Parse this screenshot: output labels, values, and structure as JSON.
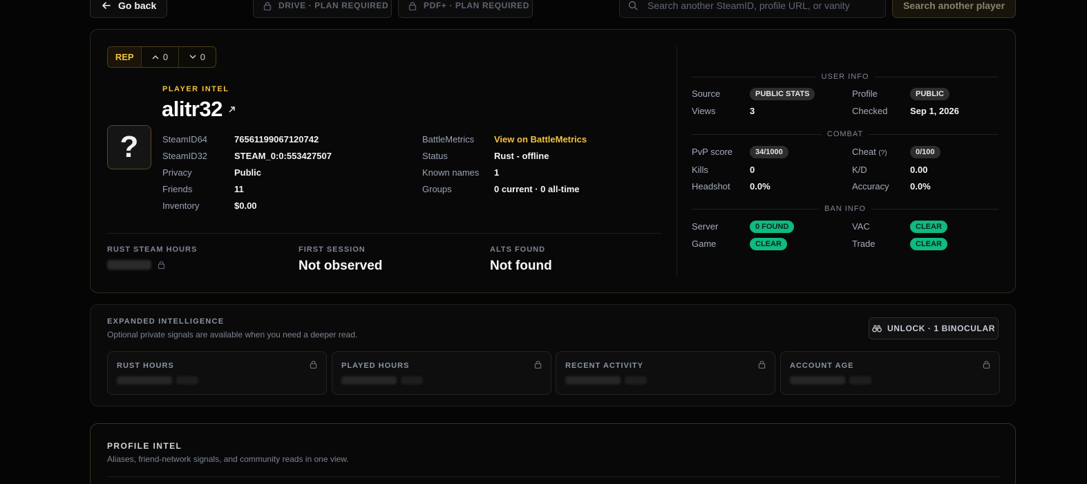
{
  "topbar": {
    "back_label": "Go back",
    "drive_label": "DRIVE · PLAN REQUIRED",
    "pdf_label": "PDF+ · PLAN REQUIRED",
    "search_placeholder": "Search another SteamID, profile URL, or vanity",
    "search_button": "Search another player"
  },
  "rep": {
    "label": "REP",
    "up": "0",
    "down": "0"
  },
  "player": {
    "tag": "PLAYER INTEL",
    "name": "alitr32",
    "avatar_glyph": "?",
    "fields_left": [
      {
        "k": "SteamID64",
        "v": "76561199067120742"
      },
      {
        "k": "SteamID32",
        "v": "STEAM_0:0:553427507"
      },
      {
        "k": "Privacy",
        "v": "Public"
      },
      {
        "k": "Friends",
        "v": "11"
      },
      {
        "k": "Inventory",
        "v": "$0.00"
      }
    ],
    "fields_right": [
      {
        "k": "BattleMetrics",
        "v": "View on BattleMetrics"
      },
      {
        "k": "Status",
        "v": "Rust - offline"
      },
      {
        "k": "Known names",
        "v": "1"
      },
      {
        "k": "Groups",
        "v": "0 current · 0 all-time"
      }
    ]
  },
  "stats": {
    "rust_hours_label": "RUST STEAM HOURS",
    "first_session_label": "FIRST SESSION",
    "first_session_value": "Not observed",
    "alts_label": "ALTS FOUND",
    "alts_value": "Not found"
  },
  "user_info": {
    "title": "USER INFO",
    "source_k": "Source",
    "source_v": "PUBLIC STATS",
    "profile_k": "Profile",
    "profile_v": "PUBLIC",
    "views_k": "Views",
    "views_v": "3",
    "checked_k": "Checked",
    "checked_v": "Sep 1, 2026"
  },
  "combat": {
    "title": "COMBAT",
    "pvp_k": "PvP score",
    "pvp_v": "34/1000",
    "cheat_k": "Cheat",
    "cheat_hint": "(?)",
    "cheat_v": "0/100",
    "kills_k": "Kills",
    "kills_v": "0",
    "kd_k": "K/D",
    "kd_v": "0.00",
    "headshot_k": "Headshot",
    "headshot_v": "0.0%",
    "accuracy_k": "Accuracy",
    "accuracy_v": "0.0%"
  },
  "ban_info": {
    "title": "BAN INFO",
    "server_k": "Server",
    "server_v": "0 FOUND",
    "vac_k": "VAC",
    "vac_v": "CLEAR",
    "game_k": "Game",
    "game_v": "CLEAR",
    "trade_k": "Trade",
    "trade_v": "CLEAR"
  },
  "expanded": {
    "title": "EXPANDED INTELLIGENCE",
    "subtitle": "Optional private signals are available when you need a deeper read.",
    "unlock_label": "UNLOCK · 1 BINOCULAR",
    "tiles": [
      "RUST HOURS",
      "PLAYED HOURS",
      "RECENT ACTIVITY",
      "ACCOUNT AGE"
    ]
  },
  "profile_intel": {
    "title": "PROFILE INTEL",
    "subtitle": "Aliases, friend-network signals, and community reads in one view."
  },
  "colors": {
    "accent": "#f3c23a",
    "clear_green": "#10b981",
    "background": "#050505"
  },
  "icons": [
    "arrow-left-icon",
    "lock-icon",
    "search-icon",
    "chevron-up-icon",
    "chevron-down-icon",
    "external-link-icon",
    "binoculars-icon"
  ]
}
